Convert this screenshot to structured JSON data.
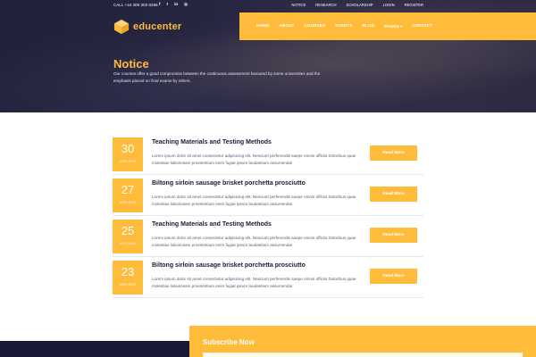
{
  "topbar": {
    "contact": "CALL +44 300 303 0266",
    "socials": [
      {
        "icon": "facebook-icon",
        "glyph": "f"
      },
      {
        "icon": "twitter-icon",
        "glyph": "t"
      },
      {
        "icon": "linkedin-icon",
        "glyph": "in"
      },
      {
        "icon": "instagram-icon",
        "glyph": "◎"
      }
    ],
    "links": [
      "NOTICE",
      "RESEARCH",
      "SCHOLARSHIP",
      "LOGIN",
      "REGISTER"
    ]
  },
  "brand": {
    "name": "educenter",
    "accent": "#ffbc3b",
    "dark": "#1a1a37"
  },
  "nav": [
    "HOME",
    "ABOUT",
    "COURSES",
    "EVENTS",
    "BLOG",
    "PAGES",
    "CONTACT"
  ],
  "hero": {
    "title": "Notice",
    "text": "Our courses offer a good compromise between the continuous assessment favoured by some universities and the emphasis placed on final exams by others."
  },
  "notices": [
    {
      "day": "30",
      "month": "APR,2019",
      "title": "Teaching Materials and Testing Methods",
      "desc": "Lorem ipsum dolor sit amet consectetur adipisicing elit. Nesciunt perferendis saepe omnis officiis Doloribus quae molestiae laboriosam proesentium enim fugiat ipsum laudantium assumenda!",
      "button": "Read More"
    },
    {
      "day": "27",
      "month": "APR,2019",
      "title": "Biltong sirloin sausage brisket porchetta prosciutto",
      "desc": "Lorem ipsum dolor sit amet consectetur adipisicing elit. Nesciunt perferendis saepe omnis officiis Doloribus quae molestiae laboriosam proesentium enim fugiat ipsum laudantium assumenda!",
      "button": "Read More"
    },
    {
      "day": "25",
      "month": "APR,2019",
      "title": "Teaching Materials and Testing Methods",
      "desc": "Lorem ipsum dolor sit amet consectetur adipisicing elit. Nesciunt perferendis saepe omnis officiis Doloribus quae molestiae laboriosam proesentium enim fugiat ipsum laudantium assumenda!",
      "button": "Read More"
    },
    {
      "day": "23",
      "month": "APR,2019",
      "title": "Biltong sirloin sausage brisket porchetta prosciutto",
      "desc": "Lorem ipsum dolor sit amet consectetur adipisicing elit. Nesciunt perferendis saepe omnis officiis Doloribus quae molestiae laboriosam proesentium enim fugiat ipsum laudantium assumenda!",
      "button": "Read More"
    }
  ],
  "subscribe": {
    "label": "Subscribe Now"
  }
}
